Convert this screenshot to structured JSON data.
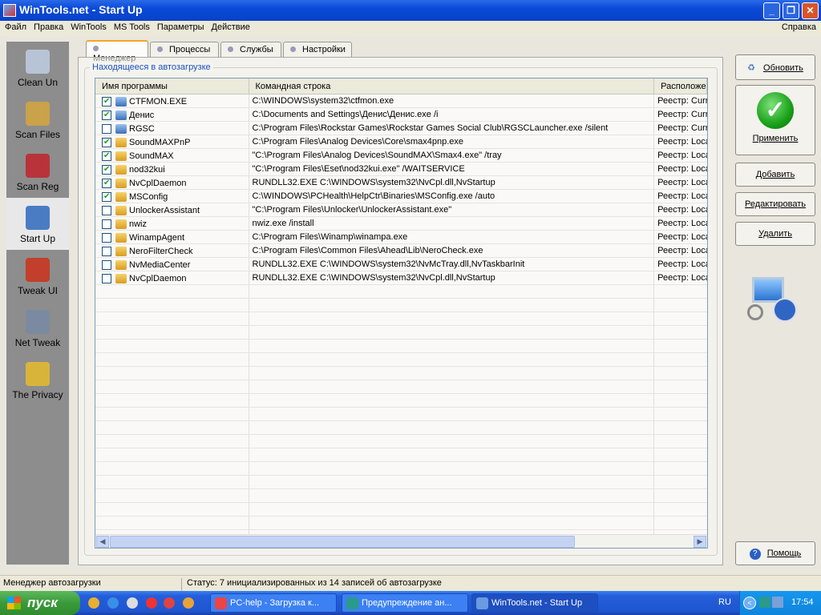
{
  "window": {
    "title": "WinTools.net - Start Up"
  },
  "menu": [
    "Файл",
    "Правка",
    "WinTools",
    "MS Tools",
    "Параметры",
    "Действие"
  ],
  "menu_help": "Справка",
  "sidebar": [
    {
      "label": "Clean Un",
      "icon": "clean-uninstaller-icon",
      "color": "#b7c4d6"
    },
    {
      "label": "Scan Files",
      "icon": "scan-files-icon",
      "color": "#c9a24a"
    },
    {
      "label": "Scan Reg",
      "icon": "scan-reg-icon",
      "color": "#b8343a"
    },
    {
      "label": "Start Up",
      "icon": "start-up-icon",
      "color": "#4a7cc4",
      "active": true
    },
    {
      "label": "Tweak UI",
      "icon": "tweak-ui-icon",
      "color": "#c23f2b"
    },
    {
      "label": "Net Tweak",
      "icon": "net-tweak-icon",
      "color": "#7b8aa0"
    },
    {
      "label": "The Privacy",
      "icon": "privacy-key-icon",
      "color": "#d9b43a"
    }
  ],
  "tabs": [
    "Менеджер",
    "Процессы",
    "Службы",
    "Настройки"
  ],
  "group_label": "Находящееся в автозагрузке",
  "table": {
    "columns": [
      "Имя программы",
      "Командная строка",
      "Расположен"
    ],
    "rows": [
      {
        "checked": true,
        "type": "exe",
        "name": "CTFMON.EXE",
        "cmd": "C:\\WINDOWS\\system32\\ctfmon.exe",
        "loc": "Реестр: Curr"
      },
      {
        "checked": true,
        "type": "exe",
        "name": "Денис",
        "cmd": "C:\\Documents and Settings\\Денис\\Денис.exe /i",
        "loc": "Реестр: Curr"
      },
      {
        "checked": false,
        "type": "exe",
        "name": "RGSC",
        "cmd": "C:\\Program Files\\Rockstar Games\\Rockstar Games Social Club\\RGSCLauncher.exe /silent",
        "loc": "Реестр: Curr"
      },
      {
        "checked": true,
        "type": "folder",
        "name": "SoundMAXPnP",
        "cmd": "C:\\Program Files\\Analog Devices\\Core\\smax4pnp.exe",
        "loc": "Реестр: Loca"
      },
      {
        "checked": true,
        "type": "folder",
        "name": "SoundMAX",
        "cmd": "\"C:\\Program Files\\Analog Devices\\SoundMAX\\Smax4.exe\" /tray",
        "loc": "Реестр: Loca"
      },
      {
        "checked": true,
        "type": "folder",
        "name": "nod32kui",
        "cmd": "\"C:\\Program Files\\Eset\\nod32kui.exe\" /WAITSERVICE",
        "loc": "Реестр: Loca"
      },
      {
        "checked": true,
        "type": "folder",
        "name": "NvCplDaemon",
        "cmd": "RUNDLL32.EXE C:\\WINDOWS\\system32\\NvCpl.dll,NvStartup",
        "loc": "Реестр: Loca"
      },
      {
        "checked": true,
        "type": "folder",
        "name": "MSConfig",
        "cmd": "C:\\WINDOWS\\PCHealth\\HelpCtr\\Binaries\\MSConfig.exe /auto",
        "loc": "Реестр: Loca"
      },
      {
        "checked": false,
        "type": "folder",
        "name": "UnlockerAssistant",
        "cmd": "\"C:\\Program Files\\Unlocker\\UnlockerAssistant.exe\"",
        "loc": "Реестр: Loca"
      },
      {
        "checked": false,
        "type": "folder",
        "name": "nwiz",
        "cmd": "nwiz.exe /install",
        "loc": "Реестр: Loca"
      },
      {
        "checked": false,
        "type": "folder",
        "name": "WinampAgent",
        "cmd": "C:\\Program Files\\Winamp\\winampa.exe",
        "loc": "Реестр: Loca"
      },
      {
        "checked": false,
        "type": "folder",
        "name": "NeroFilterCheck",
        "cmd": "C:\\Program Files\\Common Files\\Ahead\\Lib\\NeroCheck.exe",
        "loc": "Реестр: Loca"
      },
      {
        "checked": false,
        "type": "folder",
        "name": "NvMediaCenter",
        "cmd": "RUNDLL32.EXE C:\\WINDOWS\\system32\\NvMcTray.dll,NvTaskbarInit",
        "loc": "Реестр: Loca"
      },
      {
        "checked": false,
        "type": "folder",
        "name": "NvCplDaemon",
        "cmd": "RUNDLL32.EXE C:\\WINDOWS\\system32\\NvCpl.dll,NvStartup",
        "loc": "Реестр: Loca"
      }
    ]
  },
  "buttons": {
    "refresh": "Обновить",
    "apply": "Применить",
    "add": "Добавить",
    "edit": "Редактировать",
    "delete": "Удалить",
    "help": "Помощь"
  },
  "statusbar": {
    "left": "Менеджер автозагрузки",
    "status": "Статус: 7 инициализированных из 14 записей об автозагрузке"
  },
  "taskbar": {
    "start": "пуск",
    "tasks": [
      "PC-help - Загрузка к...",
      "Предупреждение ан...",
      "WinTools.net - Start Up"
    ],
    "lang": "RU",
    "clock": "17:54"
  }
}
